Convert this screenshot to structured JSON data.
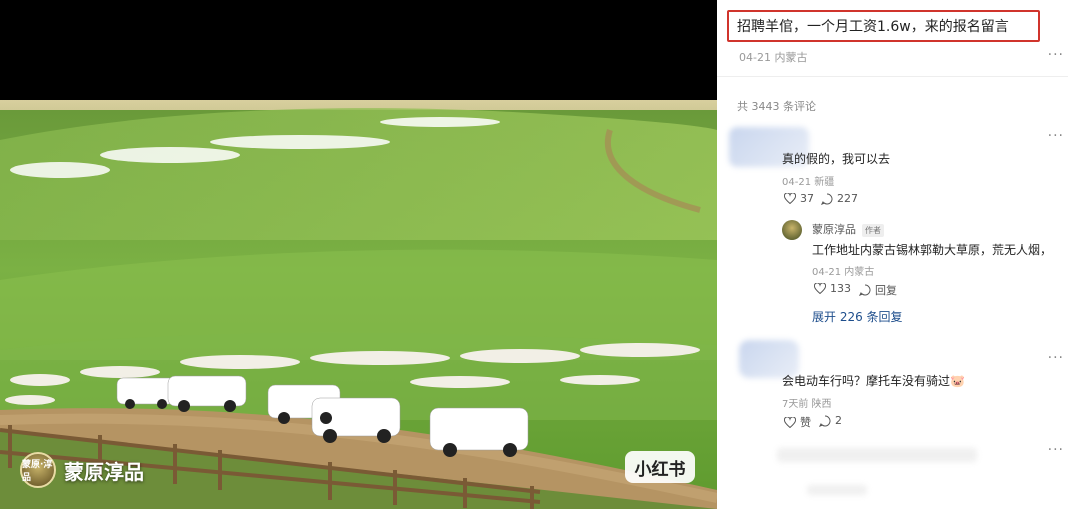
{
  "post": {
    "title": "招聘羊倌，一个月工资1.6w，来的报名留言",
    "meta": "04-21 内蒙古",
    "comment_count": "共 3443 条评论",
    "more_icon": "more-icon",
    "highlight_color": "#d0342c"
  },
  "media": {
    "watermark_text": "蒙原淳品",
    "watermark_logo_text": "蒙原·淳品",
    "platform_badge": "小红书"
  },
  "comments": [
    {
      "text": "真的假的，我可以去",
      "meta": "04-21 新疆",
      "likes": "37",
      "replies": "227"
    },
    {
      "author": "蒙原淳品",
      "author_tag": "作者",
      "text": "工作地址内蒙古锡林郭勒大草原，荒无人烟，",
      "meta": "04-21 内蒙古",
      "likes": "133",
      "reply_label": "回复"
    },
    {
      "expand": "展开 226 条回复"
    },
    {
      "text": "会电动车行吗？摩托车没有骑过🐷",
      "meta": "7天前 陕西",
      "likes": "赞",
      "replies": "2"
    }
  ]
}
